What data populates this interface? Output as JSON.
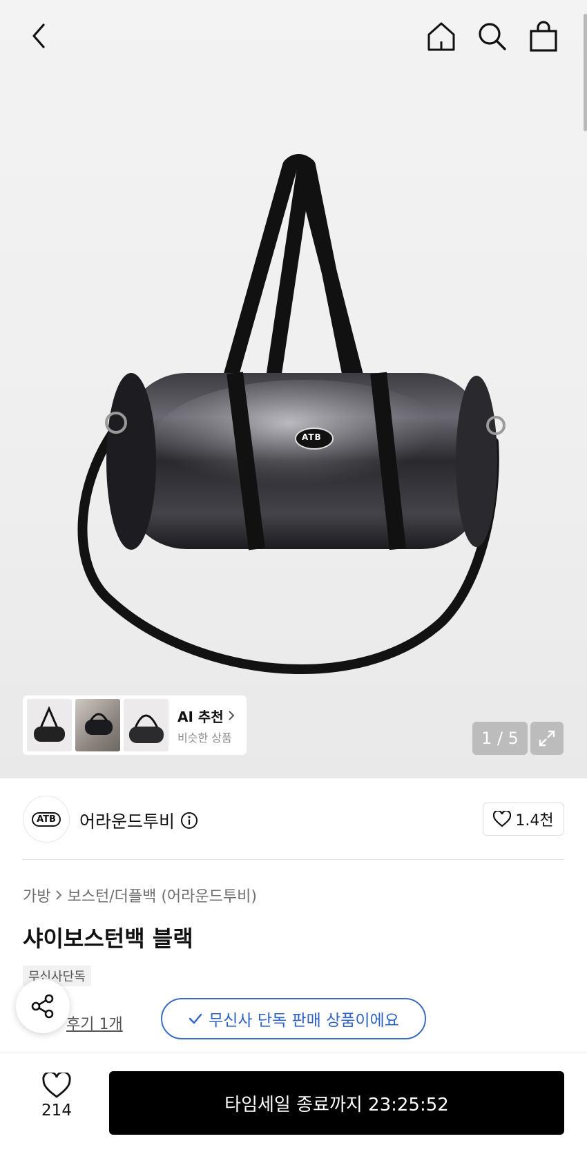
{
  "header": {
    "back_icon": "chevron-left-icon",
    "home_icon": "home-icon",
    "search_icon": "search-icon",
    "cart_icon": "shopping-bag-icon"
  },
  "gallery": {
    "logo_text": "ATB",
    "ai_card": {
      "title": "AI 추천",
      "subtitle": "비슷한 상품"
    },
    "pager": "1 / 5"
  },
  "brand": {
    "logo_text": "ATB",
    "name": "어라운드투비",
    "follow_count": "1.4천"
  },
  "product": {
    "breadcrumb": [
      "가방",
      "보스턴/더플백 (어라운드투비)"
    ],
    "title": "샤이보스턴백 블랙",
    "tag": "무신사단독",
    "review": "후기 1개",
    "exclusive_label": "무신사 단독 판매 상품이에요"
  },
  "bottom": {
    "wish_count": "214",
    "buy_label": "타임세일 종료까지 23:25:52"
  },
  "colors": {
    "accent_blue": "#2e63c2",
    "buy_button": "#000000"
  }
}
